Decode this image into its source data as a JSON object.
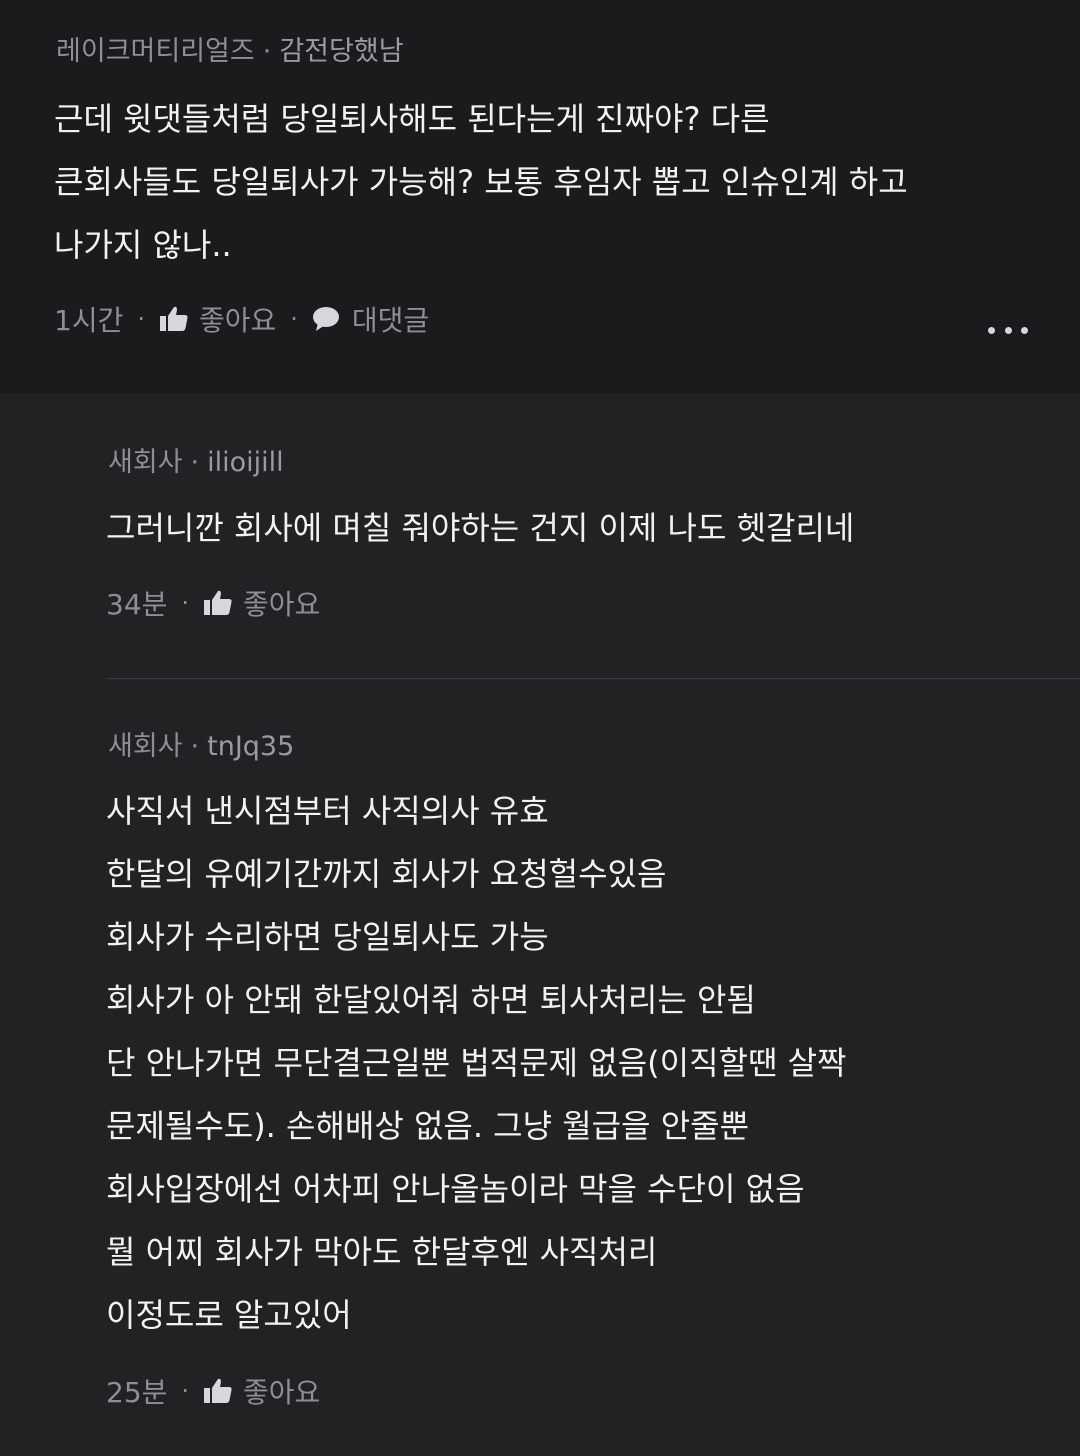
{
  "parent_comment": {
    "company": "레이크머티리얼즈",
    "separator": "·",
    "nickname": "감전당했남",
    "lines": [
      "근데 윗댓들처럼 당일퇴사해도 된다는게 진짜야? 다른",
      "큰회사들도 당일퇴사가 가능해? 보통 후임자 뽑고 인슈인계 하고",
      "나가지 않나.."
    ],
    "time": "1시간",
    "like_label": "좋아요",
    "reply_label": "대댓글",
    "more_icon": "more-horizontal-icon"
  },
  "replies": [
    {
      "company": "새회사",
      "separator": "·",
      "nickname": "ilioijill",
      "lines": [
        "그러니깐 회사에 며칠 줘야하는 건지 이제 나도 헷갈리네"
      ],
      "time": "34분",
      "like_label": "좋아요"
    },
    {
      "company": "새회사",
      "separator": "·",
      "nickname": "tnJq35",
      "lines": [
        "사직서 낸시점부터 사직의사 유효",
        "한달의 유예기간까지 회사가 요청헐수있음",
        "회사가 수리하면 당일퇴사도 가능",
        "회사가 아 안돼 한달있어줘 하면 퇴사처리는 안됨",
        "단 안나가면 무단결근일뿐 법적문제 없음(이직할땐 살짝",
        "문제될수도). 손해배상 없음. 그냥 월급을 안줄뿐",
        "회사입장에선 어차피 안나올놈이라 막을 수단이 없음",
        "뭘 어찌 회사가 막아도 한달후엔 사직처리",
        "이정도로 알고있어"
      ],
      "time": "25분",
      "like_label": "좋아요"
    }
  ],
  "colors": {
    "parent_background": "#1b1b1d",
    "reply_background": "#222224",
    "body_text": "#f2f2f2",
    "meta_text": "#8e8e93"
  }
}
